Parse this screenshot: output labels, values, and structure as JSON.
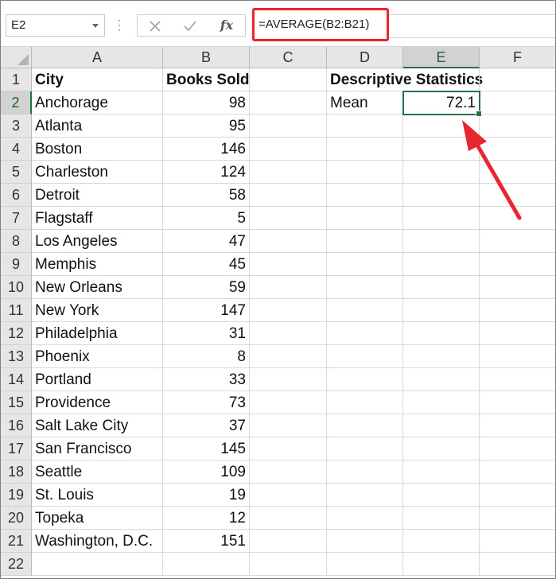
{
  "name_box": {
    "value": "E2"
  },
  "formula_bar": {
    "cancel_icon": "x-icon",
    "enter_icon": "check-icon",
    "fx_label": "fx",
    "formula": "=AVERAGE(B2:B21)"
  },
  "columns": [
    "A",
    "B",
    "C",
    "D",
    "E",
    "F"
  ],
  "selected_column": "E",
  "selected_row": "2",
  "rows": [
    "1",
    "2",
    "3",
    "4",
    "5",
    "6",
    "7",
    "8",
    "9",
    "10",
    "11",
    "12",
    "13",
    "14",
    "15",
    "16",
    "17",
    "18",
    "19",
    "20",
    "21",
    "22"
  ],
  "headers": {
    "city": "City",
    "books_sold": "Books Sold"
  },
  "data": [
    {
      "city": "Anchorage",
      "books": "98"
    },
    {
      "city": "Atlanta",
      "books": "95"
    },
    {
      "city": "Boston",
      "books": "146"
    },
    {
      "city": "Charleston",
      "books": "124"
    },
    {
      "city": "Detroit",
      "books": "58"
    },
    {
      "city": "Flagstaff",
      "books": "5"
    },
    {
      "city": "Los Angeles",
      "books": "47"
    },
    {
      "city": "Memphis",
      "books": "45"
    },
    {
      "city": "New Orleans",
      "books": "59"
    },
    {
      "city": "New York",
      "books": "147"
    },
    {
      "city": "Philadelphia",
      "books": "31"
    },
    {
      "city": "Phoenix",
      "books": "8"
    },
    {
      "city": "Portland",
      "books": "33"
    },
    {
      "city": "Providence",
      "books": "73"
    },
    {
      "city": "Salt Lake City",
      "books": "37"
    },
    {
      "city": "San Francisco",
      "books": "145"
    },
    {
      "city": "Seattle",
      "books": "109"
    },
    {
      "city": "St. Louis",
      "books": "19"
    },
    {
      "city": "Topeka",
      "books": "12"
    },
    {
      "city": "Washington, D.C.",
      "books": "151"
    }
  ],
  "stats": {
    "title": "Descriptive Statistics",
    "mean_label": "Mean",
    "mean_value": "72.1"
  },
  "colors": {
    "highlight_red": "#e8262f",
    "selection_green": "#217346"
  }
}
